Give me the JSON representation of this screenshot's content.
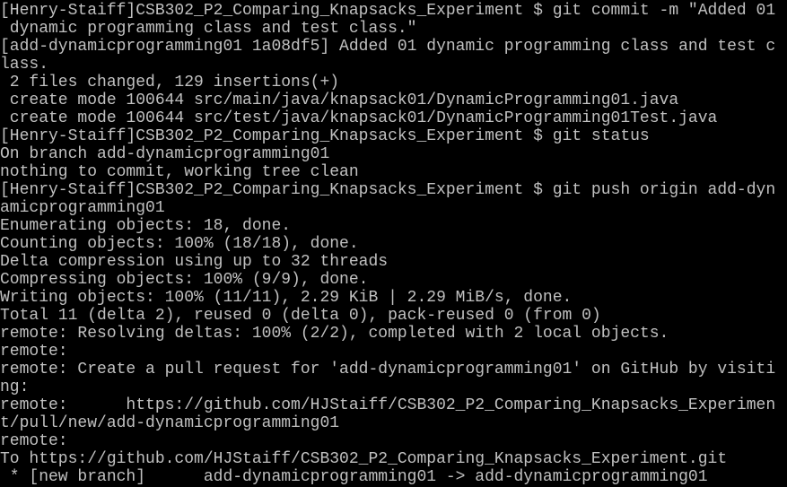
{
  "terminal": {
    "text_color": "#c0c0c0",
    "background_color": "#000000",
    "lines": [
      "[Henry-Staiff]CSB302_P2_Comparing_Knapsacks_Experiment $ git commit -m \"Added 01",
      " dynamic programming class and test class.\"",
      "[add-dynamicprogramming01 1a08df5] Added 01 dynamic programming class and test c",
      "lass.",
      " 2 files changed, 129 insertions(+)",
      " create mode 100644 src/main/java/knapsack01/DynamicProgramming01.java",
      " create mode 100644 src/test/java/knapsack01/DynamicProgramming01Test.java",
      "[Henry-Staiff]CSB302_P2_Comparing_Knapsacks_Experiment $ git status",
      "On branch add-dynamicprogramming01",
      "nothing to commit, working tree clean",
      "[Henry-Staiff]CSB302_P2_Comparing_Knapsacks_Experiment $ git push origin add-dyn",
      "amicprogramming01",
      "Enumerating objects: 18, done.",
      "Counting objects: 100% (18/18), done.",
      "Delta compression using up to 32 threads",
      "Compressing objects: 100% (9/9), done.",
      "Writing objects: 100% (11/11), 2.29 KiB | 2.29 MiB/s, done.",
      "Total 11 (delta 2), reused 0 (delta 0), pack-reused 0 (from 0)",
      "remote: Resolving deltas: 100% (2/2), completed with 2 local objects.",
      "remote:",
      "remote: Create a pull request for 'add-dynamicprogramming01' on GitHub by visiti",
      "ng:",
      "remote:      https://github.com/HJStaiff/CSB302_P2_Comparing_Knapsacks_Experimen",
      "t/pull/new/add-dynamicprogramming01",
      "remote:",
      "To https://github.com/HJStaiff/CSB302_P2_Comparing_Knapsacks_Experiment.git",
      " * [new branch]      add-dynamicprogramming01 -> add-dynamicprogramming01"
    ]
  }
}
